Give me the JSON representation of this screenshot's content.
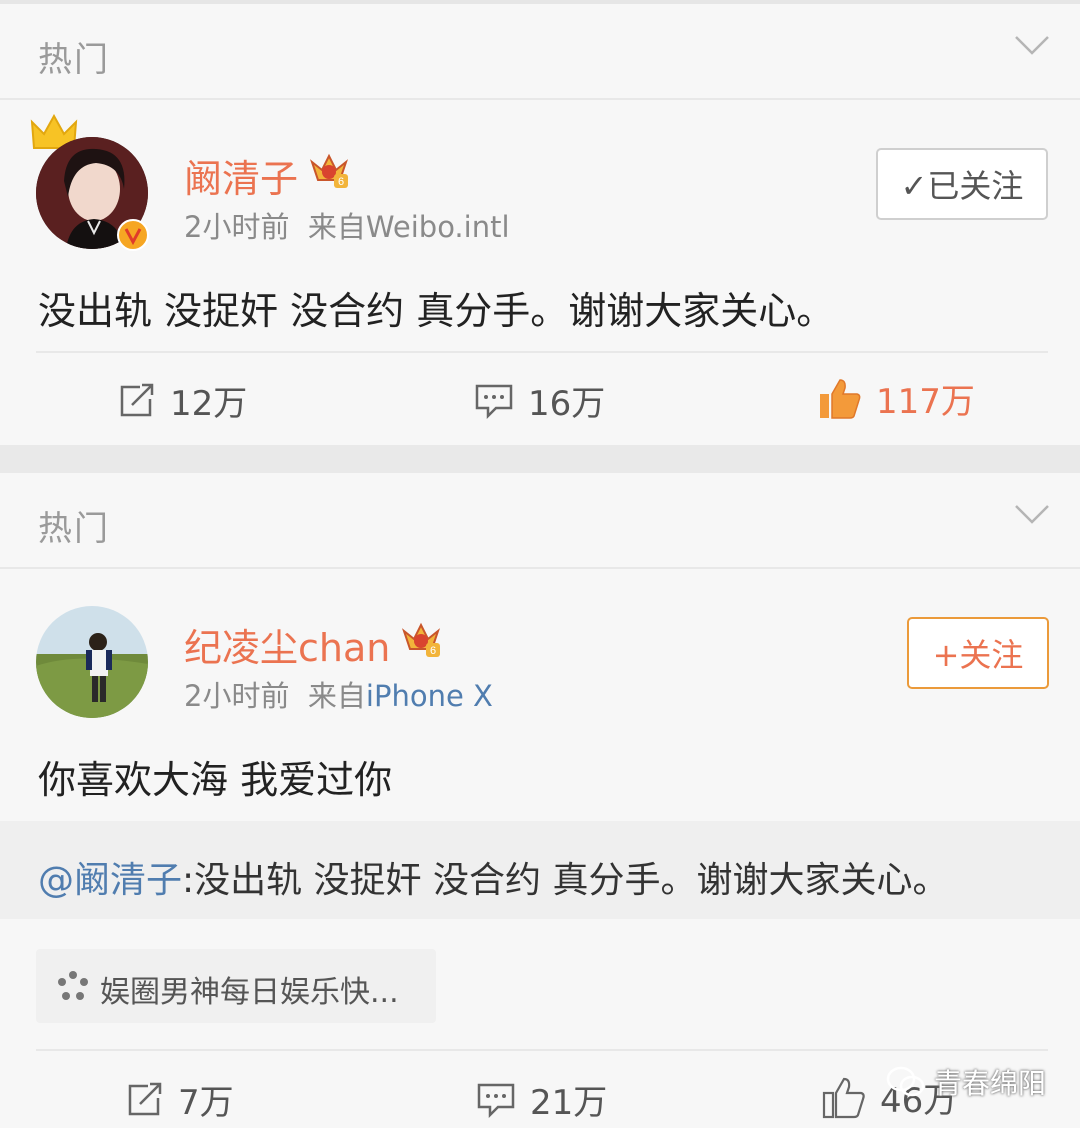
{
  "feed": [
    {
      "section_label": "热门",
      "user": {
        "name": "阚清子",
        "verified": true,
        "level_badge": "6"
      },
      "meta": {
        "time": "2小时前",
        "from_prefix": "来自",
        "source": "Weibo.intl"
      },
      "follow_button": {
        "label": "✓已关注",
        "state": "followed"
      },
      "text": "没出轨 没捉奸 没合约 真分手。谢谢大家关心。",
      "actions": {
        "repost": "12万",
        "comment": "16万",
        "like": "117万"
      }
    },
    {
      "section_label": "热门",
      "user": {
        "name": "纪凌尘chan",
        "level_badge": "6"
      },
      "meta": {
        "time": "2小时前",
        "from_prefix": "来自",
        "source": "iPhone X"
      },
      "follow_button": {
        "label": "+关注",
        "state": "not_followed"
      },
      "text": "你喜欢大海 我爱过你",
      "quoted": {
        "mention": "@阚清子",
        "text": ":没出轨 没捉奸 没合约 真分手。谢谢大家关心。"
      },
      "tag": {
        "label": "娱圈男神每日娱乐快..."
      },
      "actions": {
        "repost": "7万",
        "comment": "21万",
        "like": "46万"
      }
    }
  ],
  "watermark": {
    "label": "青春绵阳"
  },
  "colors": {
    "accent": "#eb7350",
    "link": "#507daf",
    "background": "#f7f7f7"
  },
  "icons": [
    "chevron-down-icon",
    "crown-icon",
    "vip-badge-icon",
    "verified-icon",
    "check-icon",
    "repost-icon",
    "comment-icon",
    "like-icon",
    "tag-icon",
    "wechat-icon"
  ]
}
